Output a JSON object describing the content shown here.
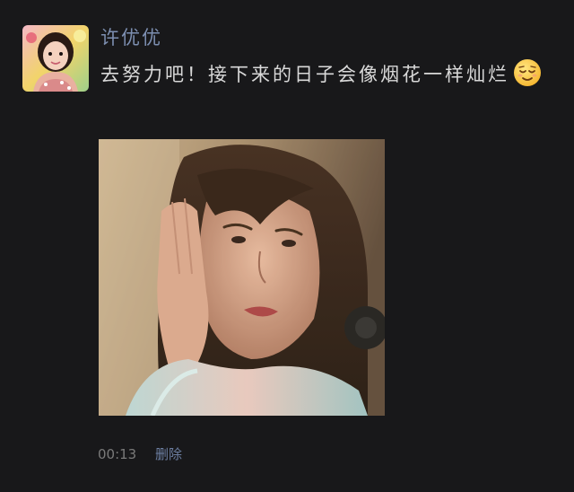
{
  "post": {
    "username": "许优优",
    "message": "去努力吧！接下来的日子会像烟花一样灿烂",
    "emoji": "relieved-face-emoji",
    "timestamp": "00:13",
    "delete_label": "删除"
  },
  "colors": {
    "background": "#18181a",
    "username": "#7d8fb1",
    "message_text": "#d9d9d9",
    "meta_text": "#7a7a7a",
    "link": "#6d7fa2"
  }
}
